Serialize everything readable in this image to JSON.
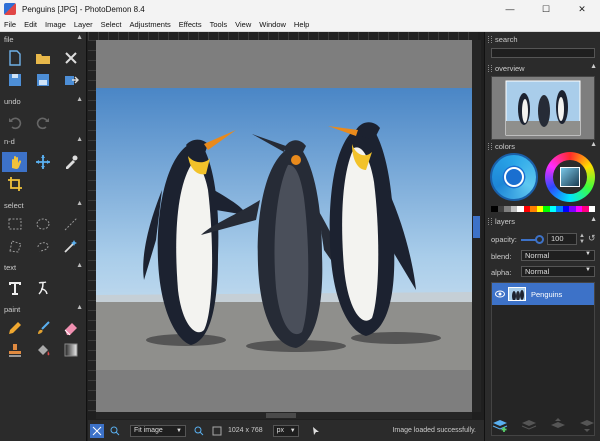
{
  "window": {
    "title": "Penguins [JPG] - PhotoDemon 8.4",
    "controls": [
      "—",
      "☐",
      "✕"
    ]
  },
  "menu": [
    "File",
    "Edit",
    "Image",
    "Layer",
    "Select",
    "Adjustments",
    "Effects",
    "Tools",
    "View",
    "Window",
    "Help"
  ],
  "left_panel": {
    "sections": [
      "file",
      "undo",
      "n-d",
      "select",
      "text",
      "paint"
    ]
  },
  "statusbar": {
    "zoom_value": "Fit image",
    "image_size": "1024 x 768",
    "unit": "px",
    "message": "Image loaded successfully."
  },
  "right_panel": {
    "search_label": "search",
    "overview_label": "overview",
    "colors_label": "colors",
    "layers_label": "layers",
    "opacity_label": "opacity:",
    "opacity_value": "100",
    "blend_label": "blend:",
    "blend_value": "Normal",
    "alpha_label": "alpha:",
    "alpha_value": "Normal",
    "layer_name": "Penguins"
  },
  "colors": {
    "accent": "#3d72c8",
    "panel": "#2b2b2b",
    "swatches": [
      "#000000",
      "#404040",
      "#808080",
      "#c0c0c0",
      "#ffffff",
      "#ff0000",
      "#ff8000",
      "#ffff00",
      "#00ff00",
      "#00ffff",
      "#0080ff",
      "#0000ff",
      "#8000ff",
      "#ff00ff",
      "#ff0080",
      "#ffffff"
    ]
  }
}
